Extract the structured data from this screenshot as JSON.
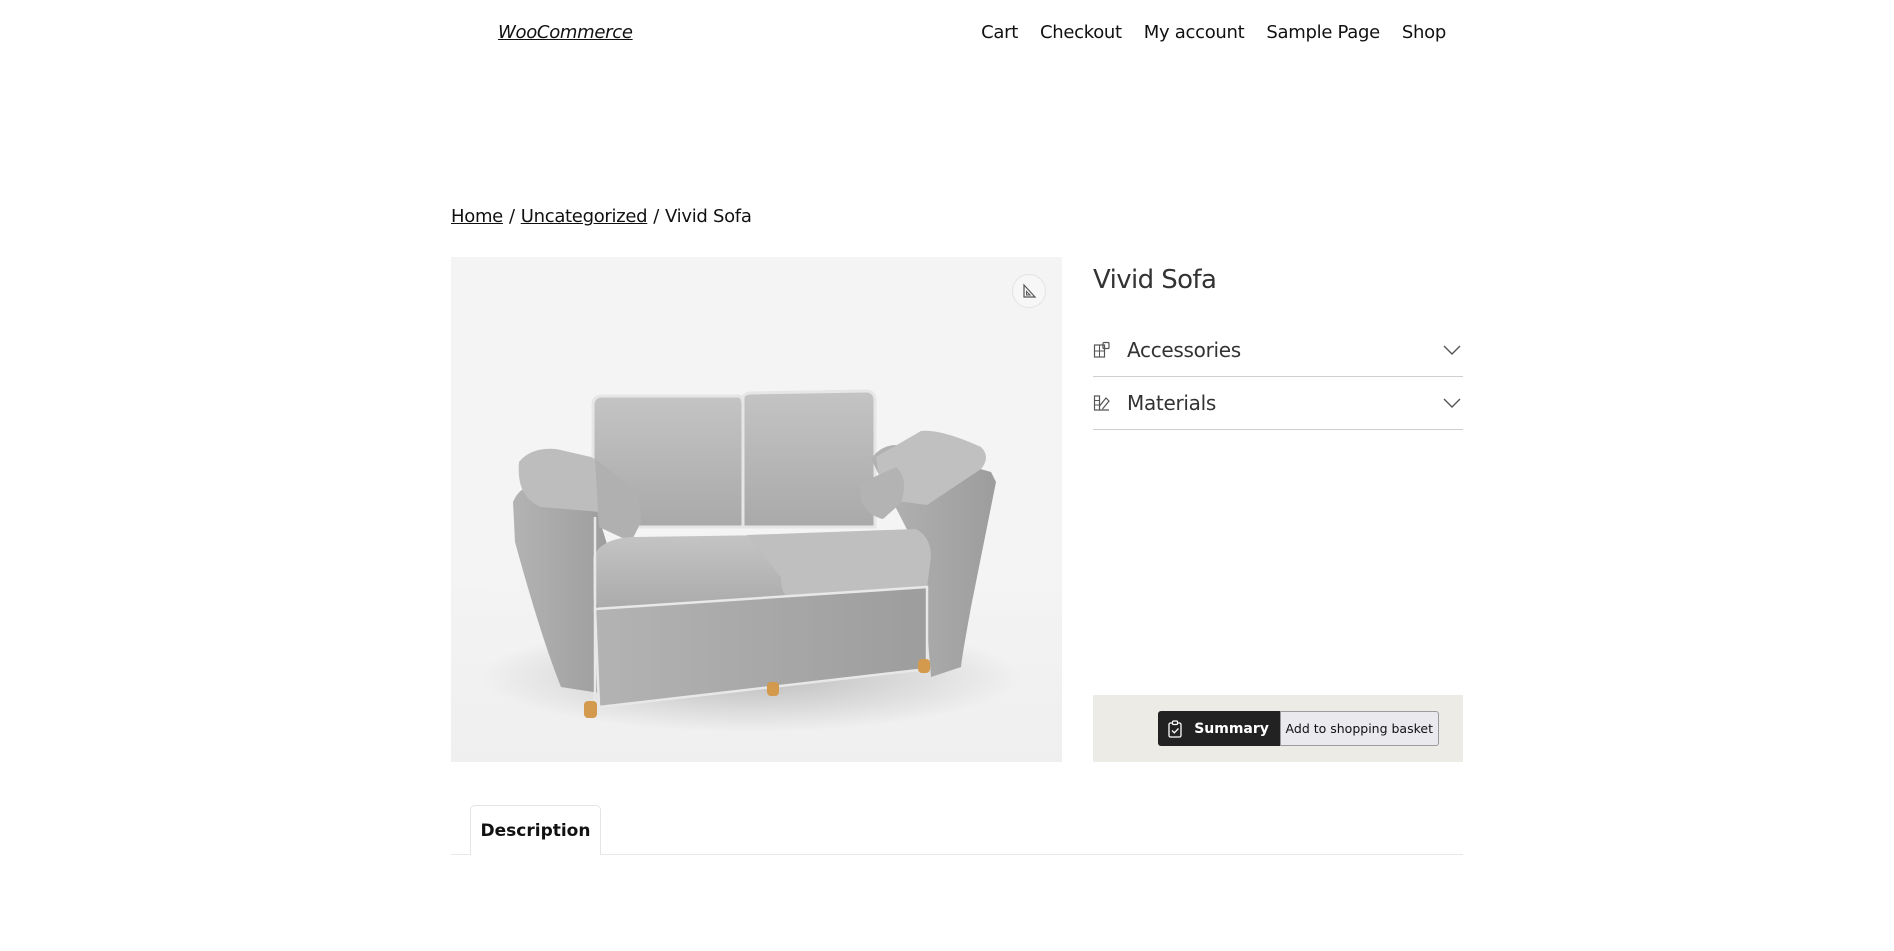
{
  "header": {
    "site_title": "WooCommerce",
    "nav": [
      {
        "label": "Cart"
      },
      {
        "label": "Checkout"
      },
      {
        "label": "My account"
      },
      {
        "label": "Sample Page"
      },
      {
        "label": "Shop"
      }
    ]
  },
  "breadcrumb": {
    "items": [
      {
        "label": "Home",
        "link": true
      },
      {
        "label": "Uncategorized",
        "link": true
      },
      {
        "label": "Vivid Sofa",
        "link": false
      }
    ],
    "separator": "/"
  },
  "viewer": {
    "product_image": "grey-fabric-two-seat-sofa",
    "dimensions_button_icon": "set-square-icon"
  },
  "product": {
    "title": "Vivid Sofa",
    "accordion": [
      {
        "label": "Accessories",
        "icon": "puzzle-icon",
        "expanded": false
      },
      {
        "label": "Materials",
        "icon": "swatch-icon",
        "expanded": false
      }
    ],
    "actions": {
      "summary_label": "Summary",
      "summary_icon": "clipboard-check-icon",
      "basket_label": "Add to shopping basket"
    }
  },
  "tabs": [
    {
      "label": "Description",
      "active": true
    }
  ],
  "colors": {
    "action_bar_bg": "#ecebe6",
    "summary_bg": "#222222",
    "viewer_bg": "#f4f4f4",
    "sofa_fabric": "#b9b9b9",
    "sofa_legs": "#d39a4e"
  }
}
